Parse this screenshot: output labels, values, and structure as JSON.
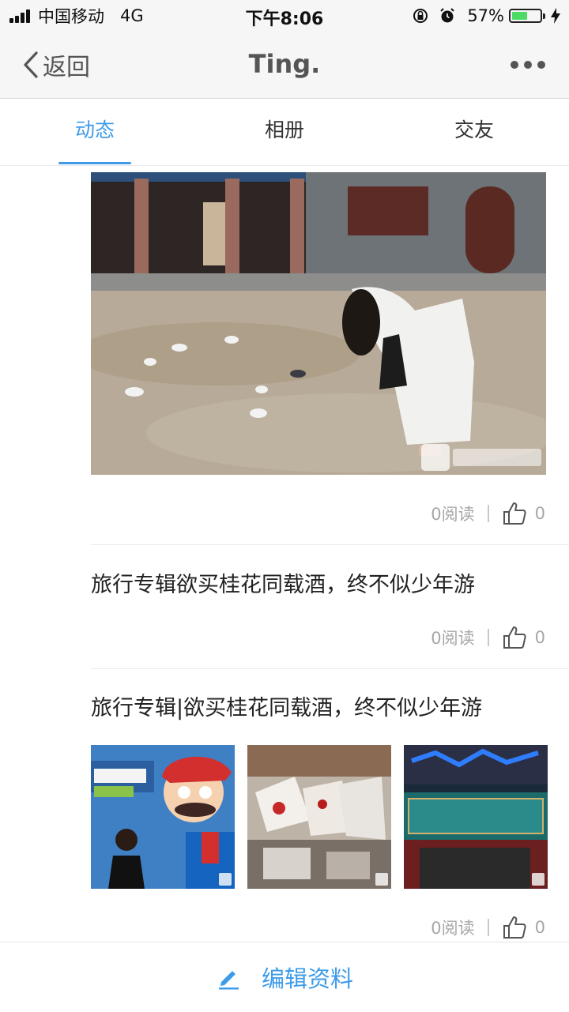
{
  "status_bar": {
    "carrier": "中国移动",
    "network": "4G",
    "time": "下午8:06",
    "battery": "57%",
    "battery_level": 0.57
  },
  "nav": {
    "back_label": "返回",
    "title": "Ting."
  },
  "tabs": [
    {
      "label": "动态"
    },
    {
      "label": "相册"
    },
    {
      "label": "交友"
    }
  ],
  "posts": [
    {
      "title": "",
      "read_count": "0阅读",
      "like_count": "0"
    },
    {
      "title": "旅行专辑欲买桂花同载酒，终不似少年游",
      "read_count": "0阅读",
      "like_count": "0"
    },
    {
      "title": "旅行专辑|欲买桂花同载酒，终不似少年游",
      "read_count": "0阅读",
      "like_count": "0"
    }
  ],
  "bottom": {
    "edit_label": "编辑资料"
  },
  "colors": {
    "accent": "#3d9be9",
    "battery_green": "#4cd964"
  }
}
